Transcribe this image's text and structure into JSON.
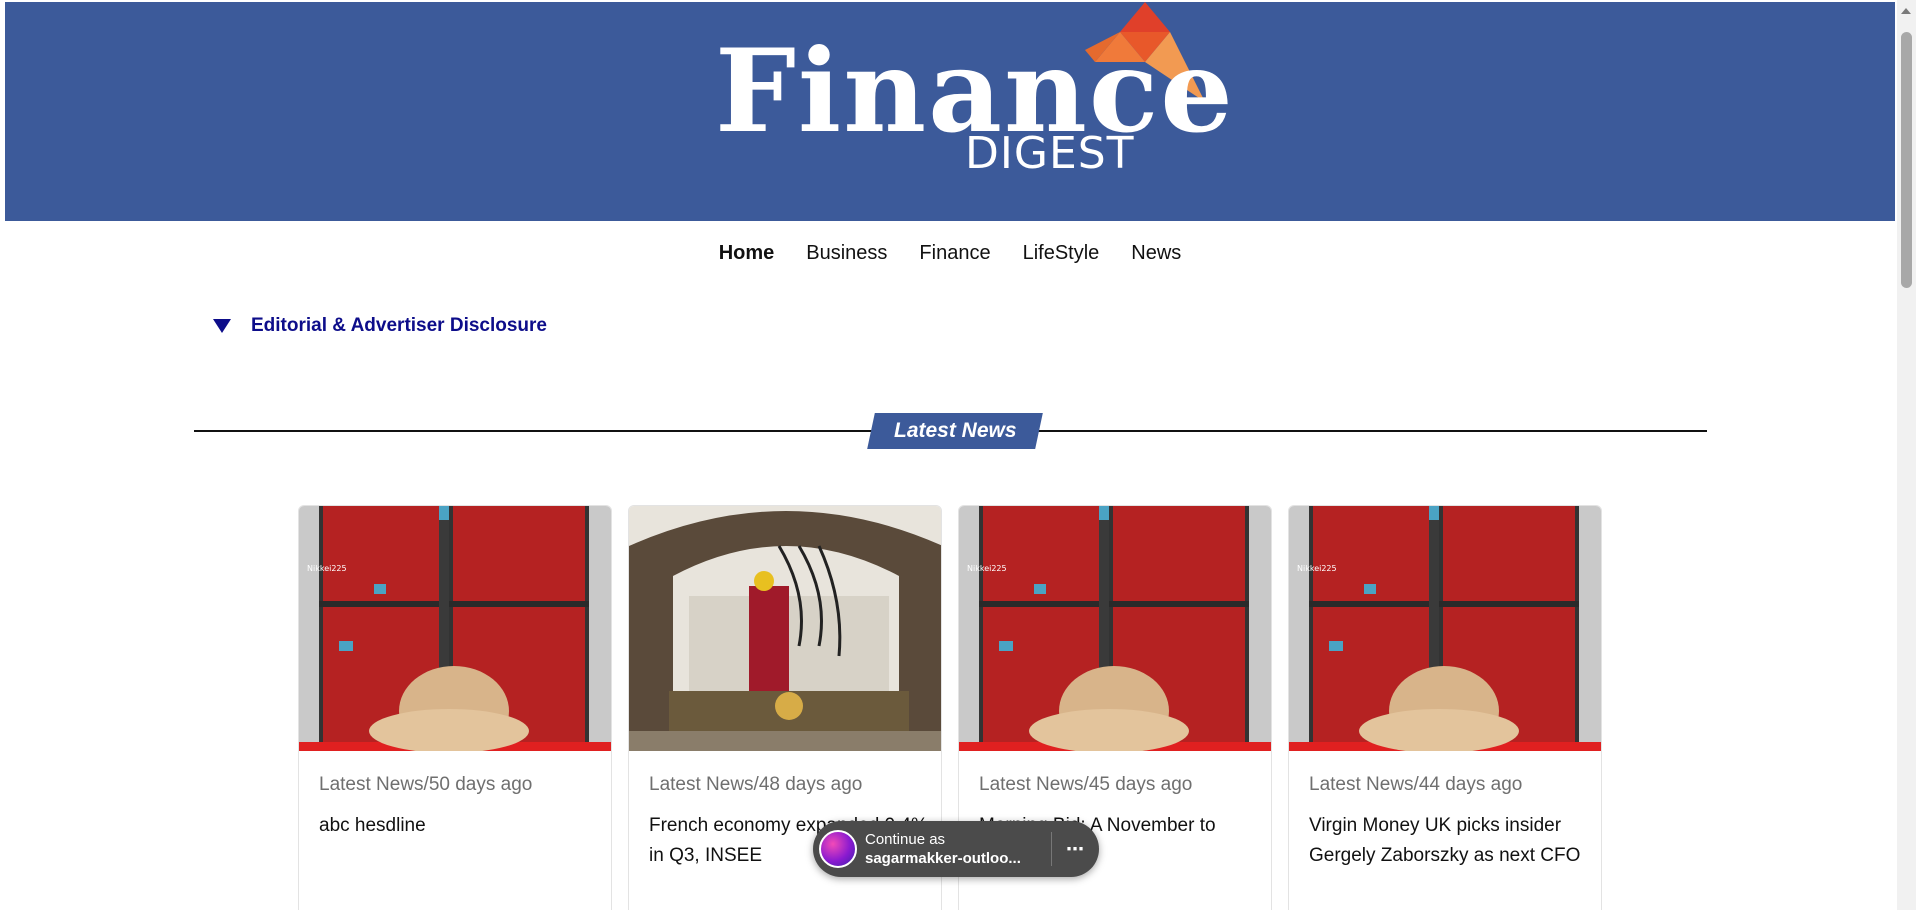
{
  "header": {
    "logo_word": "Finance",
    "logo_sub": "DIGEST",
    "brand_color": "#3c5a9a"
  },
  "nav": {
    "items": [
      {
        "label": "Home",
        "active": true
      },
      {
        "label": "Business",
        "active": false
      },
      {
        "label": "Finance",
        "active": false
      },
      {
        "label": "LifeStyle",
        "active": false
      },
      {
        "label": "News",
        "active": false
      }
    ]
  },
  "disclosure": {
    "label": "Editorial & Advertiser Disclosure",
    "icon": "triangle-down-icon"
  },
  "section": {
    "title": "Latest News"
  },
  "cards": [
    {
      "meta": "Latest News/50 days ago",
      "title": "abc hesdline",
      "image": "stock-board-photo"
    },
    {
      "meta": "Latest News/48 days ago",
      "title": "French economy expanded 0.4% in Q3, INSEE",
      "image": "factory-worker-photo"
    },
    {
      "meta": "Latest News/45 days ago",
      "title": "Morning Bid: A November to",
      "image": "stock-board-photo"
    },
    {
      "meta": "Latest News/44 days ago",
      "title": "Virgin Money UK picks insider Gergely Zaborszky as next CFO",
      "image": "stock-board-photo"
    }
  ],
  "popup": {
    "line1": "Continue as",
    "line2": "sagarmakker-outloo...",
    "more": "⋯"
  }
}
